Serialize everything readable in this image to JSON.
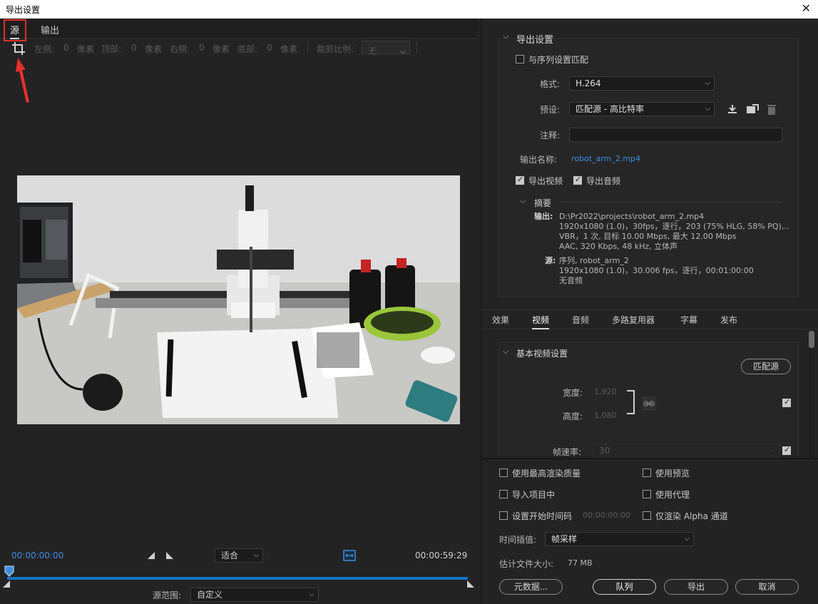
{
  "window": {
    "title": "导出设置",
    "close_glyph": "✕"
  },
  "left": {
    "tabs": [
      {
        "label": "源"
      },
      {
        "label": "输出"
      }
    ],
    "crop": {
      "left_label": "左侧:",
      "left_value": "0",
      "left_unit": "像素",
      "top_label": "顶部:",
      "top_value": "0",
      "top_unit": "像素",
      "right_label": "右侧:",
      "right_value": "0",
      "right_unit": "像素",
      "bottom_label": "底部:",
      "bottom_value": "0",
      "bottom_unit": "像素",
      "ratio_label": "裁剪比例:",
      "ratio_value": "无"
    },
    "timeline": {
      "start": "00:00:00:00",
      "end": "00:00:59:29",
      "fit": "适合",
      "source_range_label": "源范围:",
      "source_range_value": "自定义"
    }
  },
  "right": {
    "export_settings": {
      "header": "导出设置",
      "match_sequence": "与序列设置匹配",
      "format_label": "格式:",
      "format_value": "H.264",
      "preset_label": "预设:",
      "preset_value": "匹配源 - 高比特率",
      "comment_label": "注释:",
      "output_name_label": "输出名称:",
      "output_name_value": "robot_arm_2.mp4",
      "export_video": "导出视频",
      "export_audio": "导出音频",
      "summary_header": "摘要",
      "output_label": "输出:",
      "output_lines": [
        "D:\\Pr2022\\projects\\robot_arm_2.mp4",
        "1920x1080 (1.0)，30fps，逐行，203 (75% HLG, 58% PQ),..",
        "VBR，1 次, 目标 10.00 Mbps, 最大 12.00 Mbps",
        "AAC, 320 Kbps, 48  kHz, 立体声"
      ],
      "source_label": "源:",
      "source_lines": [
        "序列, robot_arm_2",
        "1920x1080 (1.0)，30.006 fps，逐行，00:01:00:00",
        "无音频"
      ]
    },
    "tabs": [
      "效果",
      "视频",
      "音频",
      "多路复用器",
      "字幕",
      "发布"
    ],
    "video": {
      "header": "基本视频设置",
      "match_source": "匹配源",
      "width_label": "宽度:",
      "width_value": "1,920",
      "height_label": "高度:",
      "height_value": "1,080",
      "fps_label": "帧速率:",
      "fps_value": "30"
    },
    "options": {
      "max_render": "使用最高渲染质量",
      "use_preview": "使用预览",
      "import_project": "导入项目中",
      "use_proxy": "使用代理",
      "set_start_tc": "设置开始时间码",
      "start_tc_value": "00:00:00:00",
      "alpha_only": "仅渲染 Alpha 通道",
      "interp_label": "时间插值:",
      "interp_value": "帧采样",
      "filesize_label": "估计文件大小:",
      "filesize_value": "77 MB"
    },
    "buttons": {
      "metadata": "元数据...",
      "queue": "队列",
      "export": "导出",
      "cancel": "取消"
    }
  },
  "colors": {
    "accent": "#3d8ee0",
    "track": "#1473c8",
    "highlight": "#e0302c"
  }
}
